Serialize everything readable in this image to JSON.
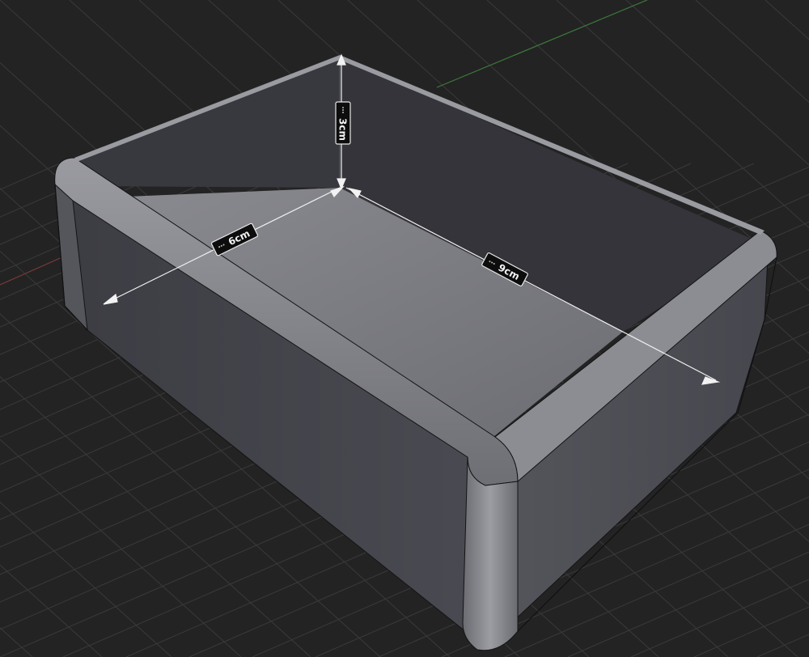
{
  "viewport": {
    "background": "#232323",
    "grid_color": "#3a3a3a",
    "axis_x_color": "#7a3b3b",
    "axis_y_color": "#3d7a3d"
  },
  "box": {
    "side_color": "#45454d",
    "inner_wall_color": "#36363c",
    "floor_color": "#7d7e84",
    "rim_color": "#8a8b91",
    "edge_color": "#141414"
  },
  "dimensions": {
    "width": {
      "label": "6cm"
    },
    "depth": {
      "label": "9cm"
    },
    "height": {
      "label": "3cm"
    }
  },
  "icons": [
    "arrow-head-icon",
    "dimension-grip-icon"
  ]
}
